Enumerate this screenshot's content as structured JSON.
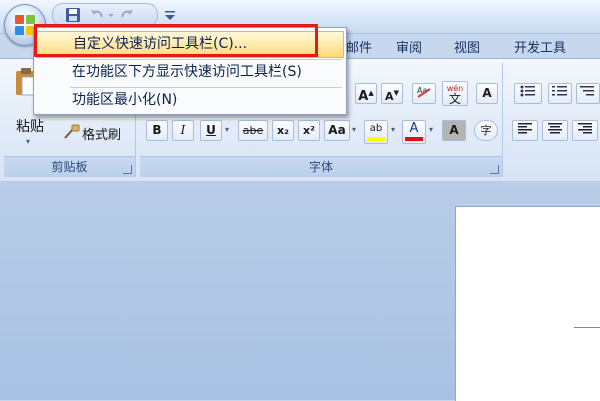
{
  "tabs": [
    {
      "label": "邮件"
    },
    {
      "label": "审阅"
    },
    {
      "label": "视图"
    },
    {
      "label": "开发工具"
    }
  ],
  "context_menu": {
    "items": [
      {
        "label": "自定义快速访问工具栏(C)..."
      },
      {
        "label": "在功能区下方显示快速访问工具栏(S)"
      },
      {
        "label": "功能区最小化(N)"
      }
    ]
  },
  "clipboard": {
    "paste_label": "粘贴",
    "format_painter_label": "格式刷",
    "group_label": "剪贴板"
  },
  "font_group": {
    "group_label": "字体",
    "bold": "B",
    "italic": "I",
    "underline": "U",
    "strikethrough": "abe",
    "subscript": "x₂",
    "superscript": "x²",
    "change_case": "Aa",
    "grow_font": "A",
    "shrink_font": "A",
    "phonetic": "wén",
    "phonetic_char": "文",
    "border_char": "A",
    "highlight": "ab",
    "font_color": "A",
    "char_shading": "A",
    "enclose_char": "字"
  },
  "colors": {
    "highlight": "#ffff00",
    "font_color": "#e01010",
    "callout": "#e21a1a"
  }
}
